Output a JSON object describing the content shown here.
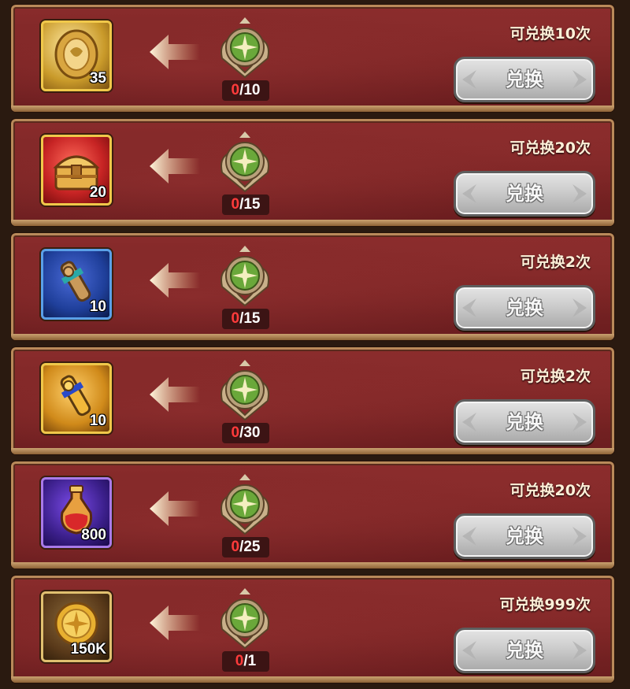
{
  "exchange_list": {
    "rows": [
      {
        "item_icon": "gold-rune-stone-icon",
        "item_quantity": "35",
        "cost_current": "0",
        "cost_total": "/10",
        "limit_text": "可兑换10次",
        "button_label": "兑换",
        "frame_color": "#f0c84a",
        "item_bg": "#b98a2a"
      },
      {
        "item_icon": "treasure-chest-icon",
        "item_quantity": "20",
        "cost_current": "0",
        "cost_total": "/15",
        "limit_text": "可兑换20次",
        "button_label": "兑换",
        "frame_color": "#f0c84a",
        "item_bg": "#c72424"
      },
      {
        "item_icon": "bronze-scroll-icon",
        "item_quantity": "10",
        "cost_current": "0",
        "cost_total": "/15",
        "limit_text": "可兑换2次",
        "button_label": "兑换",
        "frame_color": "#5aa0e8",
        "item_bg": "#1f3f9a"
      },
      {
        "item_icon": "gold-scroll-icon",
        "item_quantity": "10",
        "cost_current": "0",
        "cost_total": "/30",
        "limit_text": "可兑换2次",
        "button_label": "兑换",
        "frame_color": "#f0c84a",
        "item_bg": "#d08a1a"
      },
      {
        "item_icon": "potion-bottle-icon",
        "item_quantity": "800",
        "cost_current": "0",
        "cost_total": "/25",
        "limit_text": "可兑换20次",
        "button_label": "兑换",
        "frame_color": "#a97ae8",
        "item_bg": "#3b1f8a"
      },
      {
        "item_icon": "gold-coin-icon",
        "item_quantity": "150K",
        "cost_current": "0",
        "cost_total": "/1",
        "limit_text": "可兑换999次",
        "button_label": "兑换",
        "frame_color": "#e0c070",
        "item_bg": "#5a3a1a"
      }
    ],
    "currency_icon": "green-compass-medal-icon",
    "arrow_icon": "arrow-left-icon",
    "colors": {
      "panel": "#7a2424",
      "cost_current": "#ff3b3b",
      "limit_text": "#fff0d8",
      "button": "#c9c9c9"
    }
  }
}
